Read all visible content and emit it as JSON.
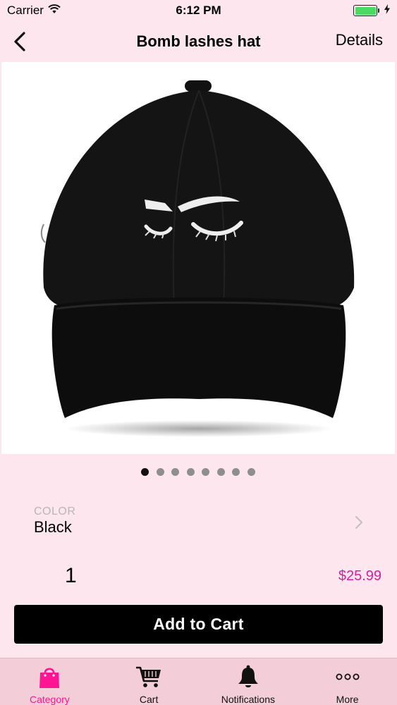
{
  "status_bar": {
    "carrier": "Carrier",
    "time": "6:12 PM"
  },
  "nav": {
    "title": "Bomb lashes hat",
    "details_label": "Details"
  },
  "gallery": {
    "page_count": 8,
    "active_page": 1
  },
  "color": {
    "label": "COLOR",
    "value": "Black"
  },
  "quantity": "1",
  "price": "$25.99",
  "add_to_cart_label": "Add to Cart",
  "tabs": [
    {
      "label": "Category",
      "icon": "shopping-bag-icon",
      "active": true
    },
    {
      "label": "Cart",
      "icon": "cart-icon",
      "active": false
    },
    {
      "label": "Notifications",
      "icon": "bell-icon",
      "active": false
    },
    {
      "label": "More",
      "icon": "more-icon",
      "active": false
    }
  ],
  "colors": {
    "background": "#fde6ee",
    "accent": "#ff1493",
    "price": "#d61fa0",
    "button": "#000000",
    "tab_bar": "#f3cdd8"
  }
}
